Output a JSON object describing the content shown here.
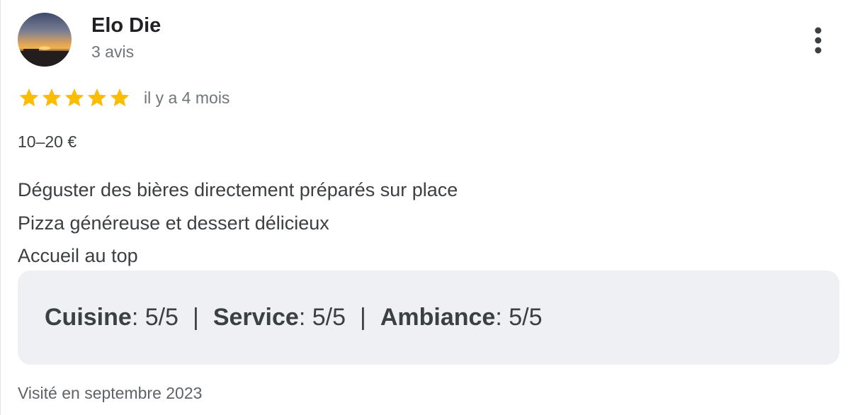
{
  "author": {
    "name": "Elo Die",
    "meta": "3 avis",
    "avatar": "sunset-avatar"
  },
  "menu_icon": "more-vert-icon",
  "rating": {
    "stars": 5,
    "max": 5,
    "time_ago": "il y a 4 mois",
    "star_color": "#fbbc04"
  },
  "price": "10–20 €",
  "body": {
    "lines": [
      "Déguster des bières directement préparés sur place",
      "Pizza généreuse et dessert délicieux",
      "Accueil au top"
    ]
  },
  "sub_ratings": [
    {
      "label": "Cuisine",
      "value": " : 5/5"
    },
    {
      "label": "Service",
      "value": " : 5/5"
    },
    {
      "label": "Ambiance",
      "value": " : 5/5"
    }
  ],
  "separator": "|",
  "visited": "Visité en septembre 2023",
  "colors": {
    "panel_bg": "#eff0f3",
    "secondary_text": "#70757a",
    "primary_text": "#202124"
  }
}
